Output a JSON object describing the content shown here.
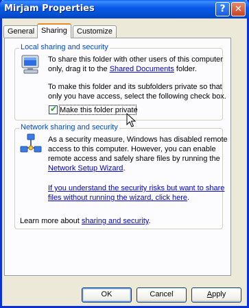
{
  "window": {
    "title": "Mirjam Properties",
    "help_label": "?",
    "close_label": "✕"
  },
  "tabs": [
    {
      "label": "General",
      "active": false
    },
    {
      "label": "Sharing",
      "active": true
    },
    {
      "label": "Customize",
      "active": false
    }
  ],
  "local": {
    "title": "Local sharing and security",
    "para1_line1": "To share this folder with other users of this computer",
    "para1_prefix": "only, drag it to the ",
    "para1_link": "Shared Documents",
    "para1_suffix": " folder.",
    "para2_line1": "To make this folder and its subfolders private so that",
    "para2_line2": "only you have access, select the following check box.",
    "checkbox_label": "Make this folder private",
    "checkbox_checked": true
  },
  "network": {
    "title": "Network sharing and security",
    "para_line1": "As a security measure, Windows has disabled remote",
    "para_line2": "access to this computer. However, you can enable",
    "para_line3": "remote access and safely share files by running the",
    "wizard_link": "Network Setup Wizard",
    "wizard_suffix": ".",
    "risk_link_line1": "If you understand the security risks but want to share",
    "risk_link_line2": "files without running the wizard, click here",
    "risk_suffix": ".",
    "learn_prefix": "Learn more about ",
    "learn_link": "sharing and security",
    "learn_suffix": "."
  },
  "buttons": {
    "ok": "OK",
    "cancel": "Cancel",
    "apply_first": "A",
    "apply_rest": "pply"
  },
  "icons": {
    "computer": "computer-icon",
    "network": "network-icon",
    "cursor": "mouse-pointer-icon"
  }
}
